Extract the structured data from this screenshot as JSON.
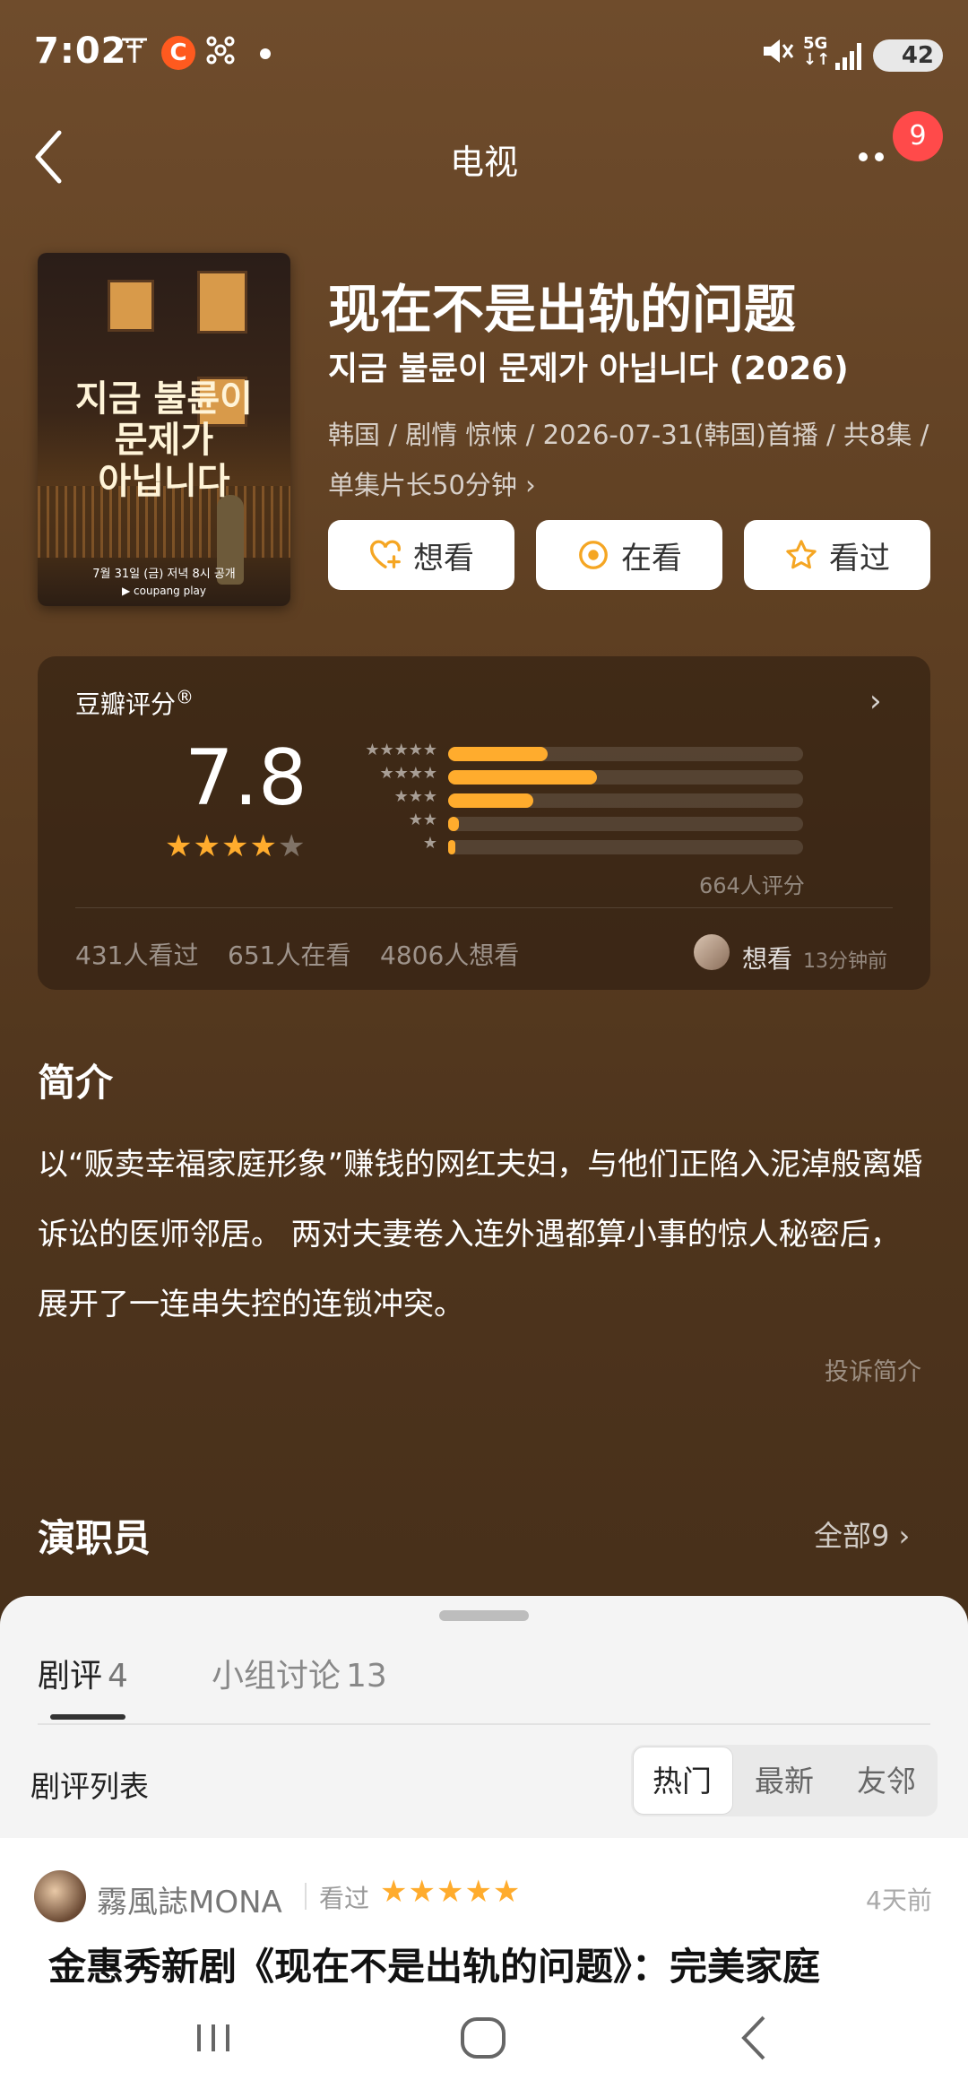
{
  "status_bar": {
    "time": "7:02",
    "icons": [
      "t-logo-icon",
      "c-app-icon",
      "network-icon",
      "dot-icon",
      "mute-icon",
      "5g-icon",
      "signal-icon",
      "battery-icon"
    ],
    "c_app": "C",
    "battery": "42"
  },
  "nav": {
    "back_icon": "chevron-left-icon",
    "title": "电视",
    "more_icon": "more-horizontal-icon",
    "badge": "9"
  },
  "poster": {
    "title_line1": "지금 불륜이",
    "title_line2": "문제가",
    "title_line3": "아닙니다",
    "date_text": "7월 31일 (금) 저녁 8시 공개",
    "brand": "▶ coupang play"
  },
  "show": {
    "title": "现在不是出轨的问题",
    "subtitle": "지금 불륜이 문제가 아닙니다 (2026)",
    "meta_line1": "韩国 / 剧情 惊悚 / 2026-07-31(韩国)首播 / 共8集 /",
    "meta_line2": "单集片长50分钟 ›"
  },
  "actions": {
    "want": "想看",
    "watching": "在看",
    "watched": "看过"
  },
  "rating": {
    "label": "豆瓣评分",
    "label_mark": "®",
    "score": "7.8",
    "stars_filled": 4,
    "stars_total": 5,
    "distribution": [
      {
        "stars": "★★★★★",
        "percent": 28
      },
      {
        "stars": "★★★★",
        "percent": 42
      },
      {
        "stars": "★★★",
        "percent": 24
      },
      {
        "stars": "★★",
        "percent": 3
      },
      {
        "stars": "★",
        "percent": 2
      }
    ],
    "count": "664人评分",
    "watched": "431人看过",
    "watching": "651人在看",
    "want": "4806人想看",
    "recent_action": "想看",
    "recent_time": "13分钟前"
  },
  "intro": {
    "heading": "简介",
    "text": "以“贩卖幸福家庭形象”赚钱的网红夫妇，与他们正陷入泥淖般离婚诉讼的医师邻居。 两对夫妻卷入连外遇都算小事的惊人秘密后，展开了一连串失控的连锁冲突。",
    "report": "投诉简介"
  },
  "cast": {
    "heading": "演职员",
    "all": "全部9 ›"
  },
  "sheet": {
    "tab1_label": "剧评",
    "tab1_count": "4",
    "tab2_label": "小组讨论",
    "tab2_count": "13",
    "list_title": "剧评列表",
    "segments": [
      "热门",
      "最新",
      "友邻"
    ],
    "active_segment": "热门"
  },
  "review": {
    "user": "霧風誌MONA",
    "status": "看过",
    "stars": "★★★★★",
    "time": "4天前",
    "title": "金惠秀新剧《现在不是出轨的问题》：完美家庭"
  },
  "system_nav": [
    "recent-apps-icon",
    "home-icon",
    "back-icon"
  ],
  "colors": {
    "accent_star": "#ffac2d",
    "badge": "#ff4a4a",
    "background": "#5e3f22"
  }
}
